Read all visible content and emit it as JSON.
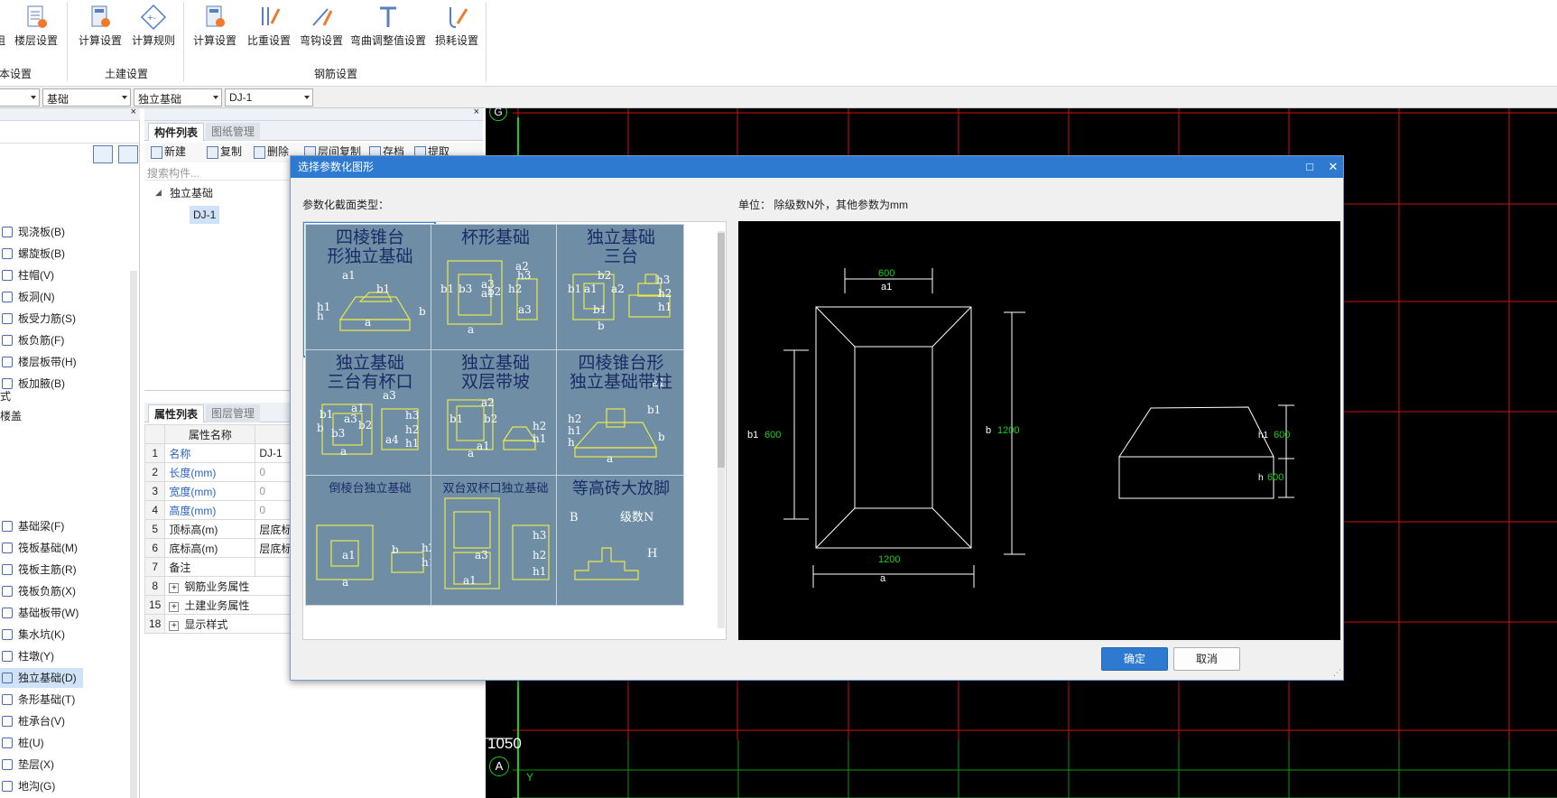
{
  "ribbon": {
    "buttons": [
      {
        "label": "楼层设置",
        "icon": "floor-settings-icon"
      },
      {
        "label": "计算设置",
        "icon": "calc-settings-icon"
      },
      {
        "label": "计算规则",
        "icon": "calc-rules-icon"
      },
      {
        "label": "计算设置",
        "icon": "rebar-calc-settings-icon"
      },
      {
        "label": "比重设置",
        "icon": "density-settings-icon"
      },
      {
        "label": "弯钩设置",
        "icon": "hook-settings-icon"
      },
      {
        "label": "弯曲调整值设置",
        "icon": "bend-adjust-icon"
      },
      {
        "label": "损耗设置",
        "icon": "loss-settings-icon"
      }
    ],
    "left_cut_label": "阻",
    "groups": [
      "本设置",
      "土建设置",
      "钢筋设置"
    ]
  },
  "selectors": [
    {
      "value": ""
    },
    {
      "value": "基础"
    },
    {
      "value": "独立基础"
    },
    {
      "value": "DJ-1"
    }
  ],
  "nav": {
    "items": [
      {
        "label": "现浇板(B)",
        "selected": false
      },
      {
        "label": "螺旋板(B)",
        "selected": false
      },
      {
        "label": "柱帽(V)",
        "selected": false
      },
      {
        "label": "板洞(N)",
        "selected": false
      },
      {
        "label": "板受力筋(S)",
        "selected": false
      },
      {
        "label": "板负筋(F)",
        "selected": false
      },
      {
        "label": "楼层板带(H)",
        "selected": false
      },
      {
        "label": "板加腋(B)",
        "selected": false
      }
    ],
    "cut_labels": [
      "式",
      "楼盖"
    ],
    "items2": [
      {
        "label": "基础梁(F)",
        "selected": false
      },
      {
        "label": "筏板基础(M)",
        "selected": false
      },
      {
        "label": "筏板主筋(R)",
        "selected": false
      },
      {
        "label": "筏板负筋(X)",
        "selected": false
      },
      {
        "label": "基础板带(W)",
        "selected": false
      },
      {
        "label": "集水坑(K)",
        "selected": false
      },
      {
        "label": "柱墩(Y)",
        "selected": false
      },
      {
        "label": "独立基础(D)",
        "selected": true
      },
      {
        "label": "条形基础(T)",
        "selected": false
      },
      {
        "label": "桩承台(V)",
        "selected": false
      },
      {
        "label": "桩(U)",
        "selected": false
      },
      {
        "label": "垫层(X)",
        "selected": false
      },
      {
        "label": "地沟(G)",
        "selected": false
      }
    ]
  },
  "component_panel": {
    "tabs": [
      "构件列表",
      "图纸管理"
    ],
    "toolbar": [
      "新建",
      "复制",
      "删除",
      "层间复制",
      "存档",
      "提取"
    ],
    "search_placeholder": "搜索构件...",
    "tree_root": "独立基础",
    "tree_child": "DJ-1"
  },
  "property_panel": {
    "tabs": [
      "属性列表",
      "图层管理"
    ],
    "header": "属性名称",
    "rows": [
      {
        "num": "1",
        "name": "名称",
        "value": "DJ-1",
        "style": "blue"
      },
      {
        "num": "2",
        "name": "长度(mm)",
        "value": "0",
        "style": "blue-gray"
      },
      {
        "num": "3",
        "name": "宽度(mm)",
        "value": "0",
        "style": "blue-gray"
      },
      {
        "num": "4",
        "name": "高度(mm)",
        "value": "0",
        "style": "blue-gray"
      },
      {
        "num": "5",
        "name": "顶标高(m)",
        "value": "层底标",
        "style": "plain"
      },
      {
        "num": "6",
        "name": "底标高(m)",
        "value": "层底标",
        "style": "plain"
      },
      {
        "num": "7",
        "name": "备注",
        "value": "",
        "style": "plain"
      },
      {
        "num": "8",
        "name": "钢筋业务属性",
        "value": "",
        "style": "expand"
      },
      {
        "num": "15",
        "name": "土建业务属性",
        "value": "",
        "style": "expand"
      },
      {
        "num": "18",
        "name": "显示样式",
        "value": "",
        "style": "expand"
      }
    ]
  },
  "canvas": {
    "axis_top": "G",
    "axis_bottom": "A",
    "dim_label": "1050",
    "y_axis": "Y",
    "colors": {
      "grid_red": "#d01010",
      "grid_green": "#0a9a0a",
      "axis_green": "#17d017"
    }
  },
  "dialog": {
    "title": "选择参数化图形",
    "section_label": "参数化截面类型：",
    "unit_label": "单位：  除级数N外，其他参数为mm",
    "thumbnails": [
      {
        "title": "四棱锥台\n形独立基础",
        "selected": true
      },
      {
        "title": "杯形基础",
        "selected": false
      },
      {
        "title": "独立基础\n三台",
        "selected": false
      },
      {
        "title": "独立基础\n三台有杯口",
        "selected": false
      },
      {
        "title": "独立基础\n双层带坡",
        "selected": false
      },
      {
        "title": "四棱锥台形\n独立基础带柱",
        "selected": false
      },
      {
        "title": "倒棱台独立基础",
        "selected": false
      },
      {
        "title": "双台双杯口独立基础",
        "selected": false
      },
      {
        "title": "等高砖大放脚",
        "selected": false
      }
    ],
    "thumb_labels": [
      "a1",
      "b1",
      "h1",
      "h",
      "a",
      "b",
      "a3",
      "b3",
      "a2",
      "b2",
      "h3",
      "h2",
      "a4",
      "B",
      "级数N",
      "H"
    ],
    "preview": {
      "a1": "600",
      "a1_label": "a1",
      "b1": "600",
      "b1_label": "b1",
      "b": "1200",
      "b_label": "b",
      "a": "1200",
      "a_label": "a",
      "h1": "600",
      "h1_label": "h1",
      "h": "600",
      "h_label": "h"
    },
    "ok_label": "确定",
    "cancel_label": "取消"
  }
}
